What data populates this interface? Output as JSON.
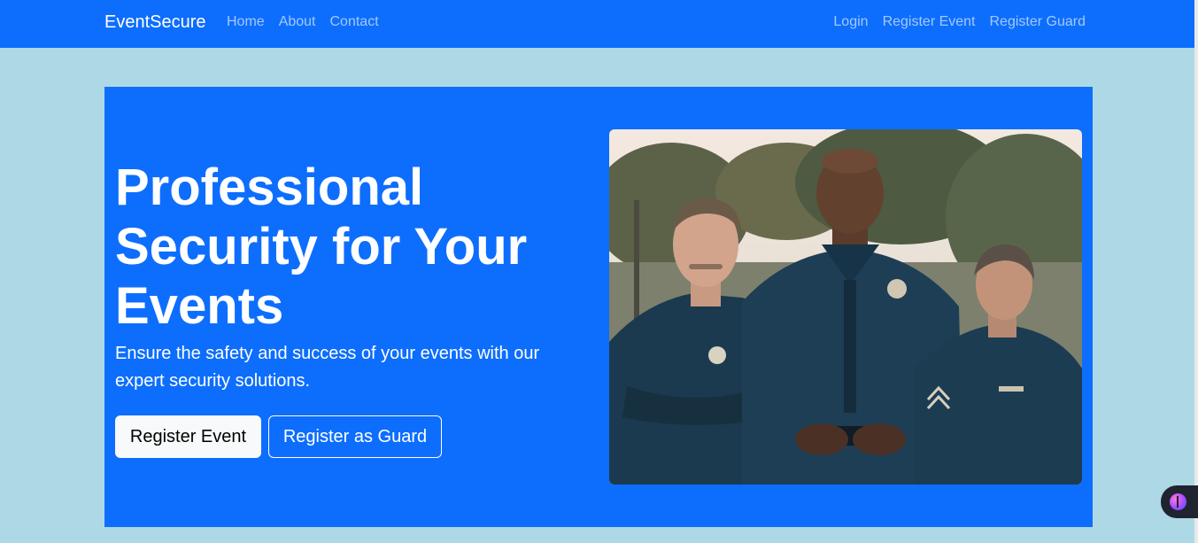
{
  "navbar": {
    "brand": "EventSecure",
    "left_links": [
      "Home",
      "About",
      "Contact"
    ],
    "right_links": [
      "Login",
      "Register Event",
      "Register Guard"
    ]
  },
  "hero": {
    "title": "Professional Security for Your Events",
    "subtitle": "Ensure the safety and success of your events with our expert security solutions.",
    "primary_button": "Register Event",
    "secondary_button": "Register as Guard",
    "image_icon": "security-officers-photo"
  },
  "widget": {
    "icon": "assistant-brain-icon"
  },
  "colors": {
    "primary": "#0d6efd",
    "page_background": "#add8e6",
    "light_button": "#f8f9fa",
    "uniform": "#1b3a4f"
  }
}
